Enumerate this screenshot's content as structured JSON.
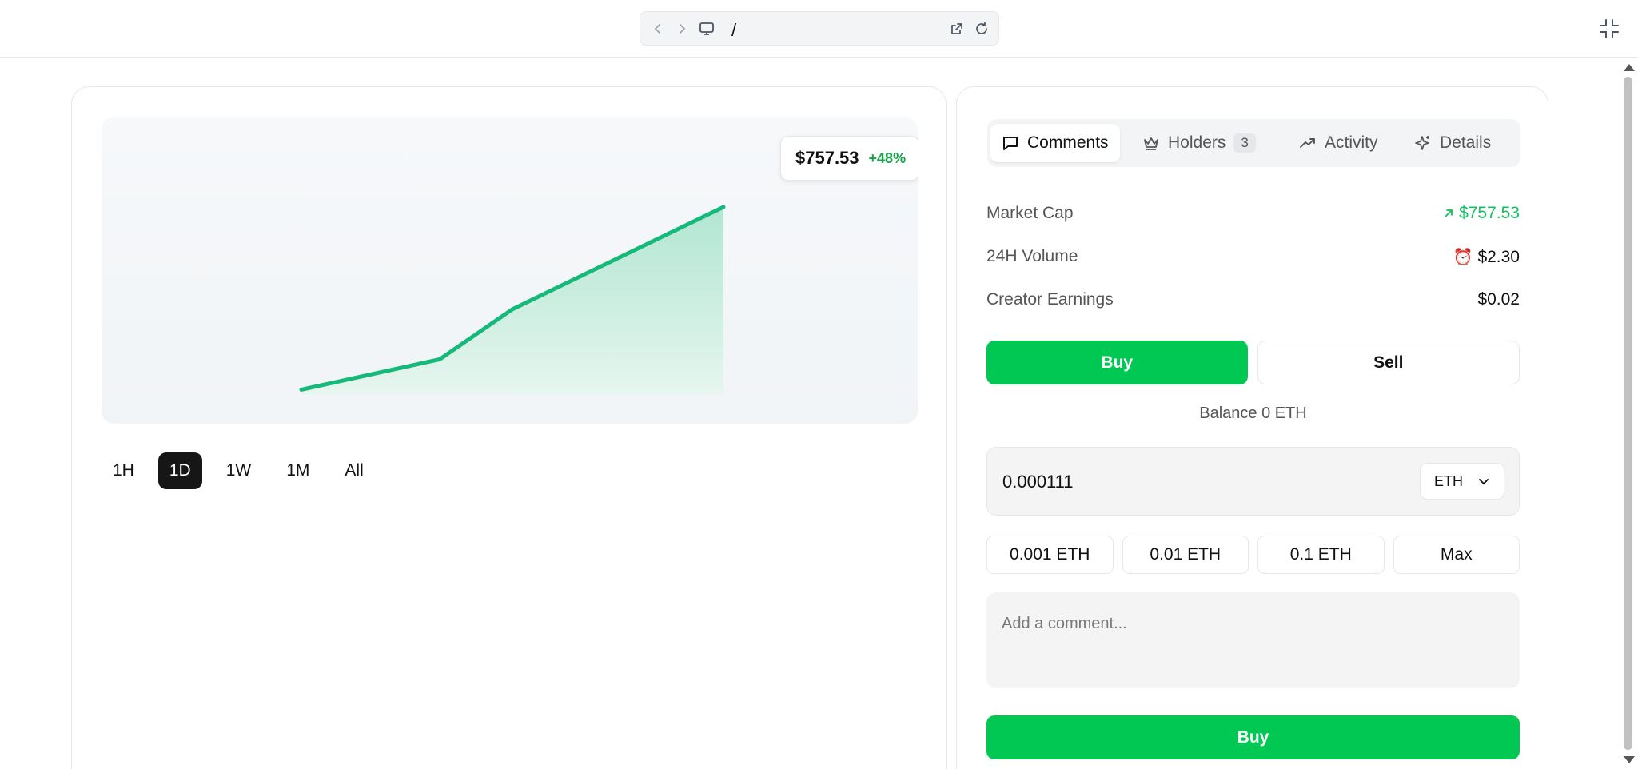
{
  "browser": {
    "path": "/",
    "icons": [
      "chevron-left-icon",
      "chevron-right-icon",
      "monitor-icon",
      "external-link-icon",
      "reload-icon",
      "collapse-icon"
    ]
  },
  "chart": {
    "price": "$757.53",
    "change": "+48%",
    "ranges": [
      "1H",
      "1D",
      "1W",
      "1M",
      "All"
    ],
    "active_range": "1D",
    "line_color": "#16b97a",
    "fill_color": "#b7e9d6"
  },
  "chart_data": {
    "type": "area",
    "x": [
      0,
      1,
      2,
      3
    ],
    "values": [
      0.16,
      0.3,
      0.53,
      1.0
    ]
  },
  "tabs": {
    "comments": "Comments",
    "holders": "Holders",
    "holders_count": "3",
    "activity": "Activity",
    "details": "Details"
  },
  "stats": {
    "market_cap_label": "Market Cap",
    "market_cap_value": "$757.53",
    "volume_label": "24H Volume",
    "volume_value": "$2.30",
    "volume_emoji": "⏰",
    "earnings_label": "Creator Earnings",
    "earnings_value": "$0.02"
  },
  "trade": {
    "buy_label": "Buy",
    "sell_label": "Sell",
    "balance": "Balance 0 ETH",
    "amount": "0.000111",
    "currency": "ETH",
    "presets": [
      "0.001 ETH",
      "0.01 ETH",
      "0.1 ETH",
      "Max"
    ],
    "comment_placeholder": "Add a comment...",
    "submit_label": "Buy"
  },
  "colors": {
    "accent_green": "#00c853",
    "positive_text": "#16c060"
  }
}
